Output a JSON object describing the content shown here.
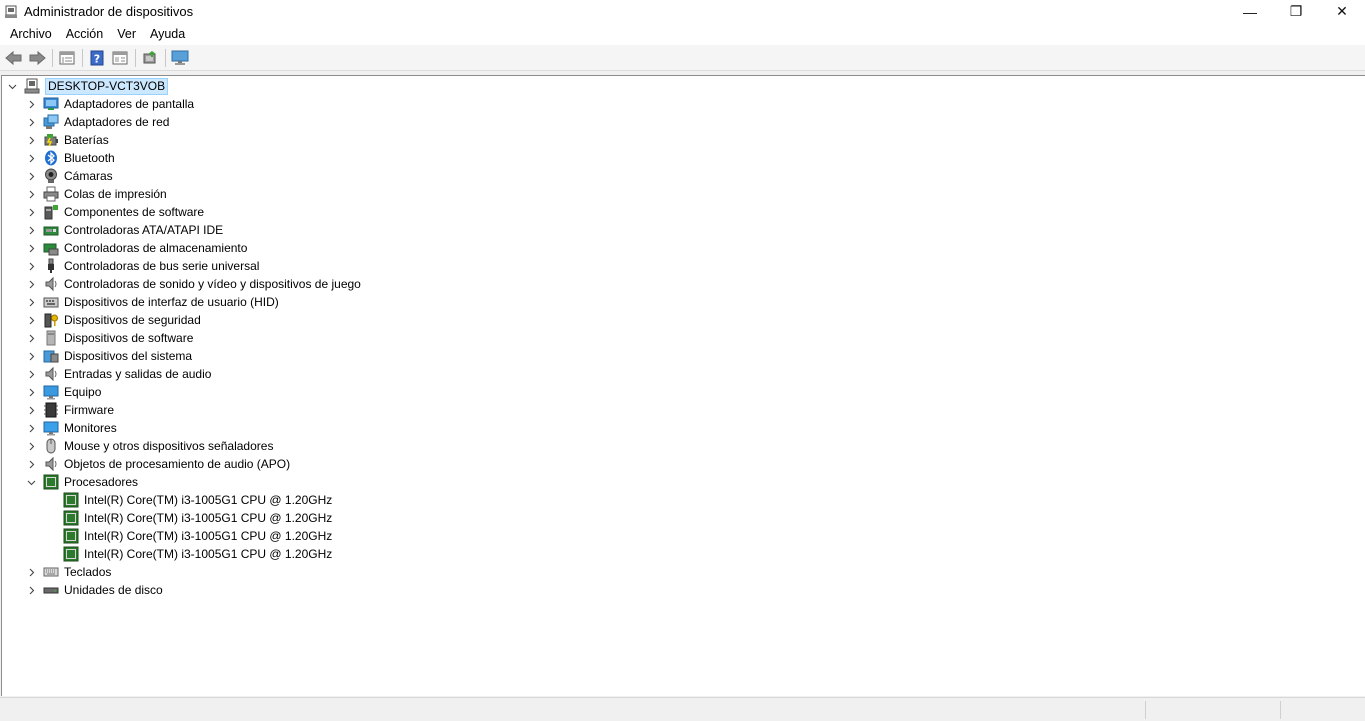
{
  "window": {
    "title": "Administrador de dispositivos",
    "controls": {
      "minimize": "—",
      "restore": "❐",
      "close": "✕"
    }
  },
  "menu": [
    "Archivo",
    "Acción",
    "Ver",
    "Ayuda"
  ],
  "toolbar": {
    "buttons": [
      "back-icon",
      "forward-icon",
      "properties-view-icon",
      "help-icon",
      "view-icon",
      "update-driver-icon",
      "monitor-icon"
    ]
  },
  "tree": {
    "root": "DESKTOP-VCT3VOB",
    "categories": [
      {
        "label": "Adaptadores de pantalla",
        "icon": "display-adapter-icon"
      },
      {
        "label": "Adaptadores de red",
        "icon": "network-adapter-icon"
      },
      {
        "label": "Baterías",
        "icon": "battery-icon"
      },
      {
        "label": "Bluetooth",
        "icon": "bluetooth-icon"
      },
      {
        "label": "Cámaras",
        "icon": "camera-icon"
      },
      {
        "label": "Colas de impresión",
        "icon": "printer-icon"
      },
      {
        "label": "Componentes de software",
        "icon": "software-component-icon"
      },
      {
        "label": "Controladoras ATA/ATAPI IDE",
        "icon": "ide-controller-icon"
      },
      {
        "label": "Controladoras de almacenamiento",
        "icon": "storage-controller-icon"
      },
      {
        "label": "Controladoras de bus serie universal",
        "icon": "usb-icon"
      },
      {
        "label": "Controladoras de sonido y vídeo y dispositivos de juego",
        "icon": "speaker-icon"
      },
      {
        "label": "Dispositivos de interfaz de usuario (HID)",
        "icon": "hid-icon"
      },
      {
        "label": "Dispositivos de seguridad",
        "icon": "security-device-icon"
      },
      {
        "label": "Dispositivos de software",
        "icon": "software-device-icon"
      },
      {
        "label": "Dispositivos del sistema",
        "icon": "system-device-icon"
      },
      {
        "label": "Entradas y salidas de audio",
        "icon": "audio-io-icon"
      },
      {
        "label": "Equipo",
        "icon": "computer-icon"
      },
      {
        "label": "Firmware",
        "icon": "firmware-icon"
      },
      {
        "label": "Monitores",
        "icon": "monitor-icon"
      },
      {
        "label": "Mouse y otros dispositivos señaladores",
        "icon": "mouse-icon"
      },
      {
        "label": "Objetos de procesamiento de audio (APO)",
        "icon": "audio-apo-icon"
      },
      {
        "label": "Procesadores",
        "icon": "processor-icon",
        "expanded": true,
        "children": [
          "Intel(R) Core(TM) i3-1005G1 CPU @ 1.20GHz",
          "Intel(R) Core(TM) i3-1005G1 CPU @ 1.20GHz",
          "Intel(R) Core(TM) i3-1005G1 CPU @ 1.20GHz",
          "Intel(R) Core(TM) i3-1005G1 CPU @ 1.20GHz"
        ]
      },
      {
        "label": "Teclados",
        "icon": "keyboard-icon"
      },
      {
        "label": "Unidades de disco",
        "icon": "disk-drive-icon"
      }
    ]
  },
  "colors": {
    "selection": "#cce8ff",
    "selection_border": "#99d1ff"
  }
}
